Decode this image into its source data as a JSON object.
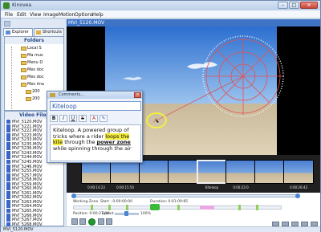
{
  "window": {
    "title": "Kinovea"
  },
  "menu": [
    "File",
    "Edit",
    "View",
    "Image",
    "Motion",
    "Options",
    "Help"
  ],
  "left_panel": {
    "tabs": [
      {
        "label": "Explorer"
      },
      {
        "label": "Shortcuts"
      }
    ],
    "folders_header": "Folders",
    "folders": [
      "Local S",
      "Ma mus",
      "Menu D",
      "Mes doc",
      "Mes doc",
      "Mes ima",
      "200",
      "200"
    ],
    "videos_header": "Video Files",
    "files": [
      "MVI_5120.MOV",
      "MVI_5221.MOV",
      "MVI_5222.MOV",
      "MVI_5223.MOV",
      "MVI_5233.MOV",
      "MVI_5235.MOV",
      "MVI_5236.MOV",
      "MVI_5243.MOV",
      "MVI_5244.MOV",
      "MVI_5245.MOV",
      "MVI_5246.MOV",
      "MVI_5255.MOV",
      "MVI_5257.MOV",
      "MVI_5258.MOV",
      "MVI_5259.MOV",
      "MVI_5260.MOV",
      "MVI_5261.MOV",
      "MVI_5262.MOV",
      "MVI_5263.MOV",
      "MVI_5264.MOV",
      "MVI_5265.MOV",
      "MVI_5266.MOV",
      "MVI_5267.MOV",
      "MVI_5268.MOV"
    ]
  },
  "video": {
    "title": "MVI_5120.MOV",
    "thumb_times": [
      "0:00:14:23",
      "0:00:15:50",
      "",
      "",
      "Kiteloop",
      "0:00:22:0",
      "",
      "0:00:26:43"
    ]
  },
  "dialog": {
    "title": "Comments...",
    "name": "Kiteloop",
    "format_buttons": [
      "B",
      "I",
      "U",
      "S",
      "A",
      "✎"
    ],
    "body": {
      "p1": "Kiteloop. A powered group of tricks where a rider ",
      "hl1": "loops the kite",
      "p2": " through the ",
      "bold1": "power zone",
      "p3": " while spinning through the air"
    }
  },
  "timeline": {
    "working_zone": "Working Zone",
    "start": "Start : 0:00:00:00",
    "duration": "Duration: 0:01:09:85",
    "position": "Position: 0:00:21:08",
    "speed_label": "Speed:",
    "speed_value": "100%"
  },
  "statusbar": {
    "text": "MVI_5120.MOV"
  }
}
